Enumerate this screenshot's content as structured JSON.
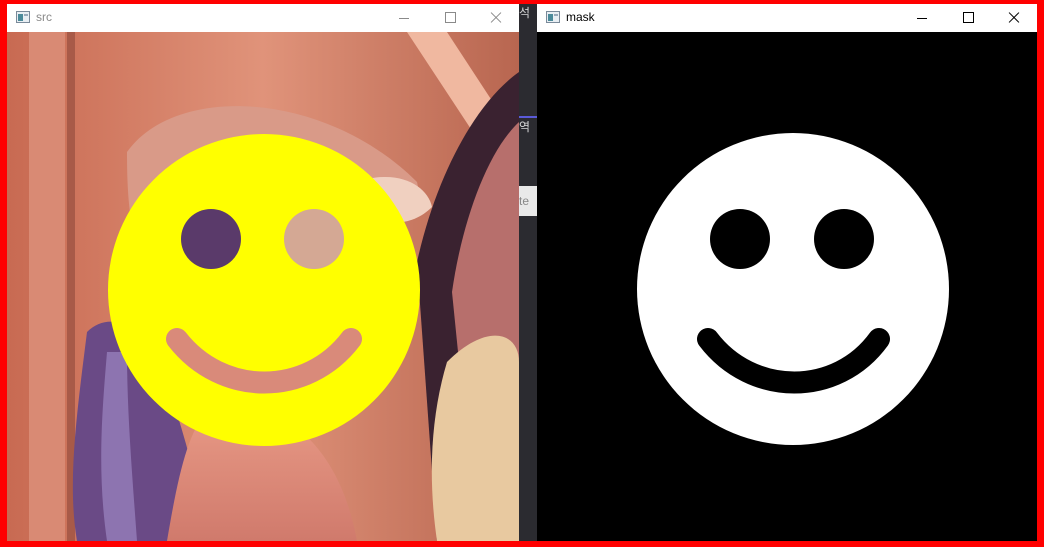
{
  "windows": {
    "src": {
      "title": "src",
      "active": false
    },
    "mask": {
      "title": "mask",
      "active": true
    }
  },
  "background_app": {
    "glyph_top": "석",
    "glyph_mid": "역",
    "pane_text": "te"
  },
  "colors": {
    "frame": "#ff0000",
    "smiley_fill": "#ffff00",
    "mask_background": "#000000",
    "mask_smiley": "#ffffff",
    "inactive_title_text": "#8a8a8a",
    "active_title_text": "#000000"
  },
  "icons": {
    "app": "app-icon",
    "minimize": "minimize-icon",
    "maximize": "maximize-icon",
    "close": "close-icon"
  }
}
